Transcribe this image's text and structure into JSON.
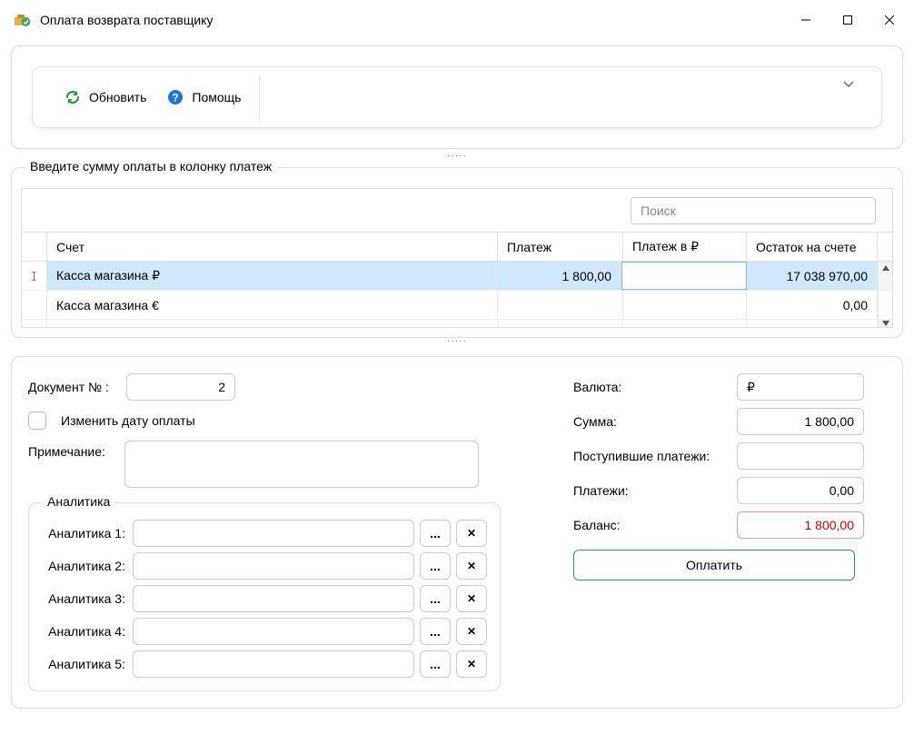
{
  "window": {
    "title": "Оплата возврата поставщику"
  },
  "toolbar": {
    "refresh": "Обновить",
    "help": "Помощь"
  },
  "section": {
    "title": "Введите сумму оплаты в колонку платеж",
    "search_placeholder": "Поиск"
  },
  "grid": {
    "headers": {
      "account": "Счет",
      "payment": "Платеж",
      "payment_rub": "Платеж в ₽",
      "balance": "Остаток на счете"
    },
    "rows": [
      {
        "account": "Касса магазина ₽",
        "payment": "1 800,00",
        "payment_rub": "",
        "balance": "17 038 970,00",
        "selected": true
      },
      {
        "account": "Касса магазина €",
        "payment": "",
        "payment_rub": "",
        "balance": "0,00",
        "selected": false
      }
    ]
  },
  "form": {
    "doc_label": "Документ № :",
    "doc_number": "2",
    "change_date_label": "Изменить дату оплаты",
    "note_label": "Примечание:"
  },
  "analytics": {
    "title": "Аналитика",
    "rows": [
      {
        "label": "Аналитика 1:"
      },
      {
        "label": "Аналитика 2:"
      },
      {
        "label": "Аналитика 3:"
      },
      {
        "label": "Аналитика 4:"
      },
      {
        "label": "Аналитика 5:"
      }
    ],
    "browse": "...",
    "clear": "✕"
  },
  "right": {
    "currency_label": "Валюта:",
    "currency": "₽",
    "sum_label": "Сумма:",
    "sum": "1 800,00",
    "received_label": "Поступившие платежи:",
    "received": "",
    "payments_label": "Платежи:",
    "payments": "0,00",
    "balance_label": "Баланс:",
    "balance": "1 800,00",
    "pay_button": "Оплатить"
  }
}
